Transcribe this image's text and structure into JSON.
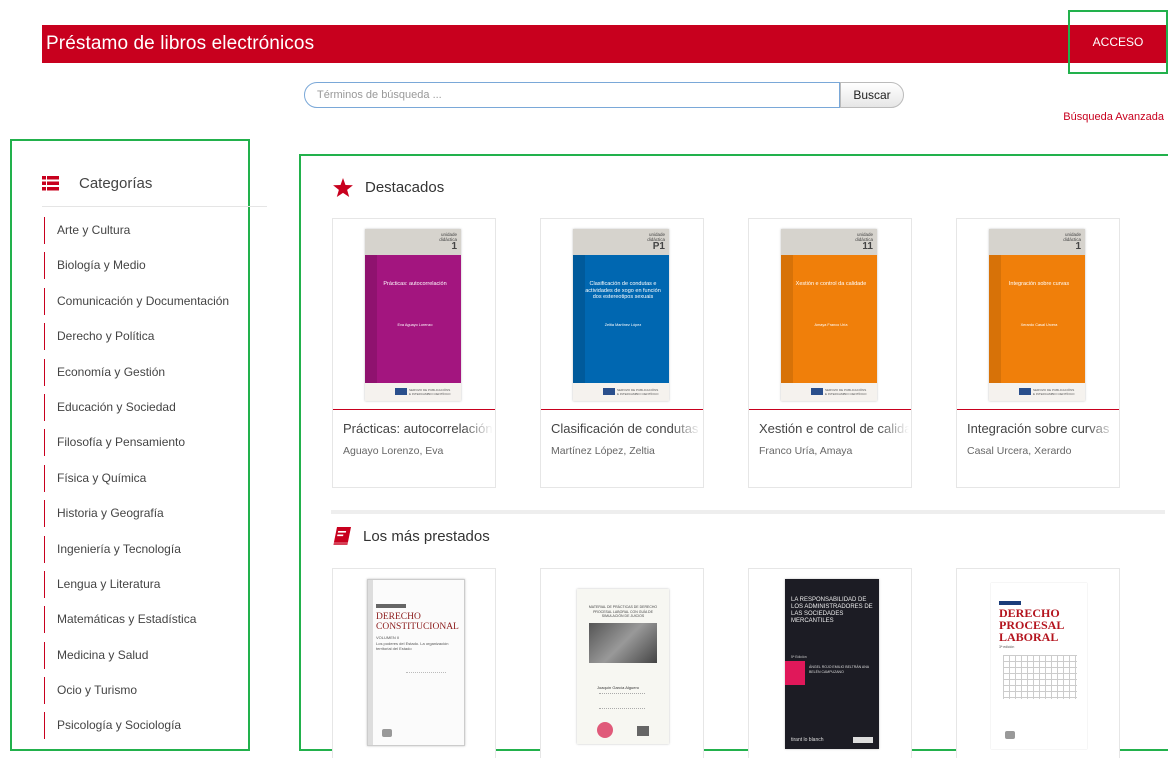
{
  "header": {
    "title": "Préstamo de libros electrónicos",
    "login_label": "ACCESO"
  },
  "search": {
    "placeholder": "Términos de búsqueda ...",
    "button_label": "Buscar",
    "advanced_label": "Búsqueda Avanzada"
  },
  "sidebar": {
    "title": "Categorías",
    "items": [
      "Arte y Cultura",
      "Biología y Medio",
      "Comunicación y Documentación",
      "Derecho y Política",
      "Economía y Gestión",
      "Educación y Sociedad",
      "Filosofía y Pensamiento",
      "Física y Química",
      "Historia y Geografía",
      "Ingeniería y Tecnología",
      "Lengua y Literatura",
      "Matemáticas y Estadística",
      "Medicina y Salud",
      "Ocio y Turismo",
      "Psicología y Sociología"
    ]
  },
  "featured": {
    "title": "Destacados",
    "books": [
      {
        "title": "Prácticas: autocorrelación",
        "author": "Aguayo Lorenzo, Eva",
        "cover_color": "#a3157f",
        "cover_unit": "1",
        "cover_text": "Prácticas: autocorrelación",
        "cover_author": "Eva Aguayo Lorenzo"
      },
      {
        "title": "Clasificación de condutas",
        "author": "Martínez López, Zeltia",
        "cover_color": "#0067b1",
        "cover_unit": "P1",
        "cover_text": "Clasificación de condutas e actividades de xogo en función dos estereotipos sexuais",
        "cover_author": "Zeltia Martínez López"
      },
      {
        "title": "Xestión e control de calidade",
        "author": "Franco Uría, Amaya",
        "cover_color": "#f07f0a",
        "cover_unit": "11",
        "cover_text": "Xestión e control da calidade",
        "cover_author": "Amaya Franco Uría"
      },
      {
        "title": "Integración sobre curvas",
        "author": "Casal Urcera, Xerardo",
        "cover_color": "#f07f0a",
        "cover_unit": "1",
        "cover_text": "Integración sobre curvas",
        "cover_author": "Xerardo Casal Urcera"
      }
    ]
  },
  "most_borrowed": {
    "title": "Los más prestados",
    "books": [
      {
        "cover_title": "DERECHO CONSTITUCIONAL",
        "cover_sub": "VOLUMEN II",
        "cover_sub2": "Los poderes del Estado. La organización territorial del Estado"
      },
      {
        "cover_title": "MATERIAL DE PRÁCTICAS DE DERECHO PROCESAL LABORAL CON GUÍA DE SIMULACIÓN DE JUICIOS",
        "cover_author": "Joaquín García Alguero"
      },
      {
        "cover_title": "LA RESPONSABILIDAD DE LOS ADMINISTRADORES DE LAS SOCIEDADES MERCANTILES",
        "cover_edition": "5ª Edición",
        "cover_authors": "ÁNGEL ROJO  EMILIO BELTRÁN  ANA BELÉN CAMPUZANO",
        "cover_publisher": "tirant lo blanch"
      },
      {
        "cover_title": "DERECHO PROCESAL LABORAL",
        "cover_edition": "3ª edición"
      }
    ]
  },
  "colors": {
    "brand": "#c8001e",
    "highlight": "#22b14c"
  }
}
